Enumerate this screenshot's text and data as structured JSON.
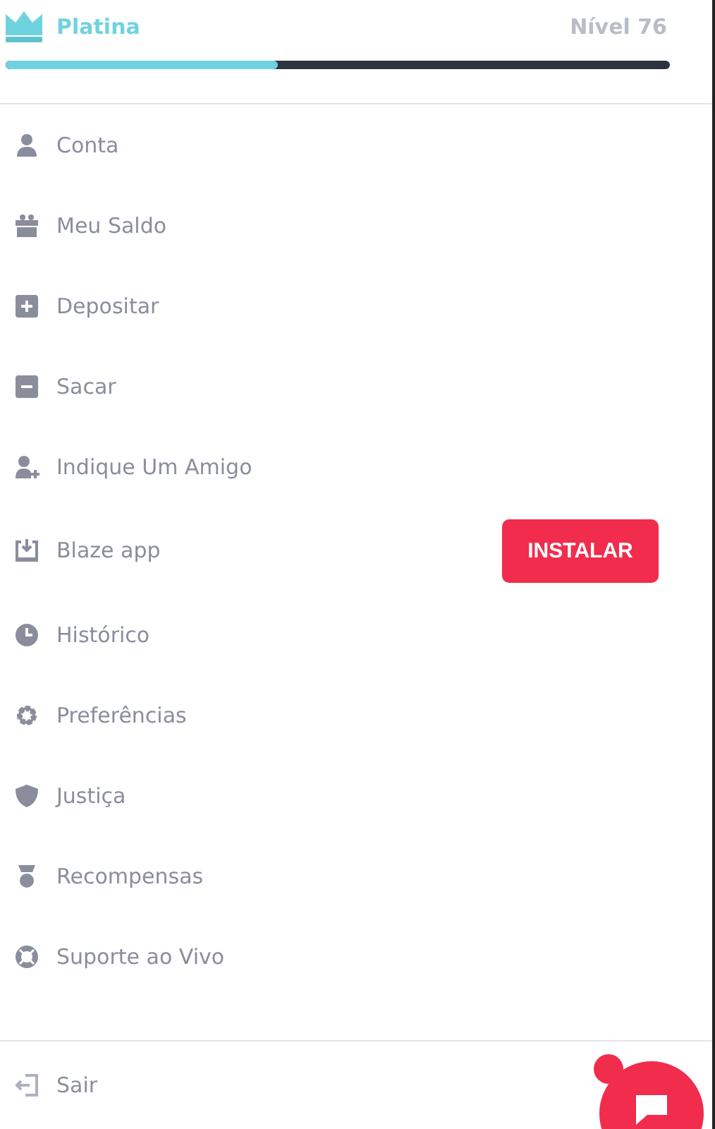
{
  "tier": {
    "name": "Platina",
    "level_label": "Nível 76",
    "level": 0.41
  },
  "menu": [
    {
      "kind": "link",
      "label": "Conta"
    },
    {
      "kind": "link",
      "label": "Meu Saldo"
    },
    {
      "kind": "link",
      "label": "Depositar"
    },
    {
      "kind": "link",
      "label": "Sacar"
    },
    {
      "kind": "link",
      "label": "Indique Um Amigo"
    },
    {
      "kind": "action",
      "label": "Blaze app",
      "button": "INSTALAR"
    },
    {
      "kind": "link",
      "label": "Histórico"
    },
    {
      "kind": "link",
      "label": "Preferências"
    },
    {
      "kind": "link",
      "label": "Justiça"
    },
    {
      "kind": "link",
      "label": "Recompensas"
    },
    {
      "kind": "link",
      "label": "Suporte ao Vivo"
    }
  ],
  "logout": {
    "label": "Sair"
  }
}
